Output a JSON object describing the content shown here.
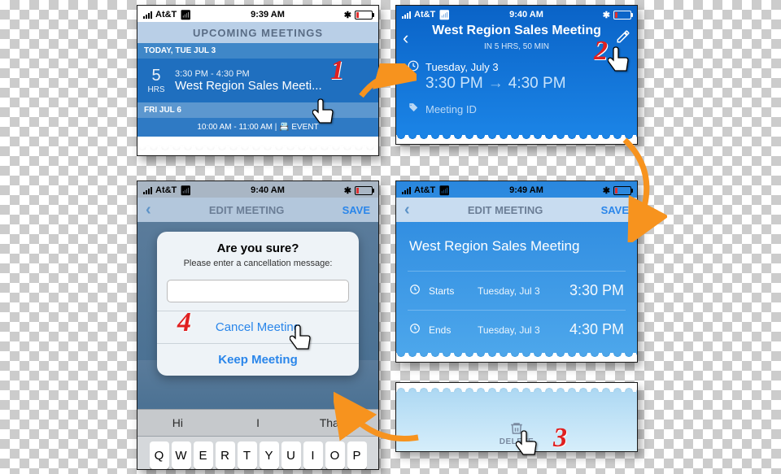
{
  "status": {
    "carrier": "At&T",
    "times": {
      "p1": "9:39 AM",
      "p2": "9:40 AM",
      "p3": "9:49 AM",
      "p4": "9:40 AM"
    }
  },
  "steps": {
    "s1": "1",
    "s2": "2",
    "s3": "3",
    "s4": "4"
  },
  "p1": {
    "header": "UPCOMING MEETINGS",
    "today_label": "TODAY, TUE JUL 3",
    "hours_num": "5",
    "hours_lbl": "HRS",
    "time_range": "3:30 PM - 4:30 PM",
    "meeting_name": "West Region Sales Meeti...",
    "fri_label": "FRI JUL 6",
    "event_row": "10:00 AM - 11:00 AM | 📇 EVENT"
  },
  "p2": {
    "title": "West Region Sales Meeting",
    "subtitle": "IN 5 HRS, 50 MIN",
    "date": "Tuesday, July 3",
    "start": "3:30 PM",
    "end": "4:30 PM",
    "tag": "Meeting ID"
  },
  "p3": {
    "nav_title": "EDIT MEETING",
    "save": "SAVE",
    "title": "West Region Sales Meeting",
    "starts_lbl": "Starts",
    "ends_lbl": "Ends",
    "date": "Tuesday, Jul 3",
    "start": "3:30 PM",
    "end": "4:30 PM",
    "delete": "DELETE"
  },
  "p4": {
    "nav_title": "EDIT MEETING",
    "save": "SAVE",
    "modal_title": "Are you sure?",
    "modal_msg": "Please enter a cancellation message:",
    "cancel": "Cancel Meeting",
    "keep": "Keep Meeting",
    "sugg": [
      "Hi",
      "I",
      "Thanks"
    ],
    "keys": [
      "Q",
      "W",
      "E",
      "R",
      "T",
      "Y",
      "U",
      "I",
      "O",
      "P"
    ]
  }
}
